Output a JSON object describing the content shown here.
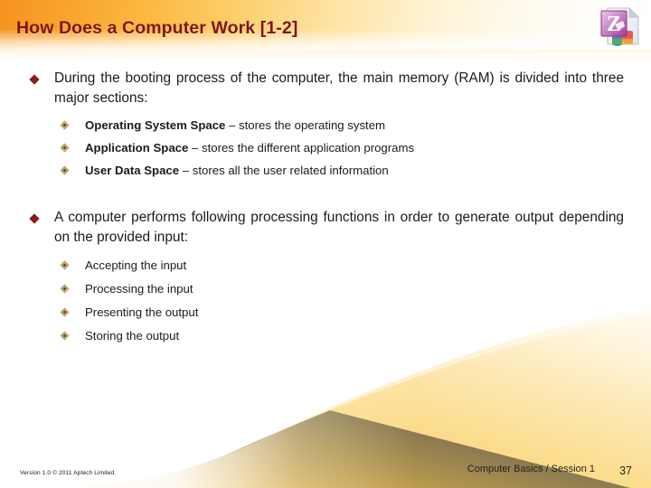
{
  "slide": {
    "title": "How Does a Computer Work [1-2]",
    "title_color": "#7d1519",
    "accent_orange": "#f5931f",
    "accent_gold": "#f7cf66",
    "bullet_color": "#8d1b1b",
    "subbullet_color": "#b59a62"
  },
  "icon": {
    "name": "zip-archive-document-icon",
    "glyph": "Z",
    "glyph_color": "#a3459b"
  },
  "body": {
    "blocks": [
      {
        "bullet": "During the booting process of the computer, the main memory (RAM) is divided into three major sections:",
        "sub_items": [
          {
            "term": "Operating System Space",
            "rest": " – stores the operating system"
          },
          {
            "term": "Application Space",
            "rest": " – stores the different application programs"
          },
          {
            "term": "User Data Space",
            "rest": " – stores all the user related information"
          }
        ]
      },
      {
        "bullet": "A computer performs following processing functions in order to generate output depending on the provided input:",
        "sub_items": [
          {
            "term": "",
            "rest": "Accepting the input"
          },
          {
            "term": "",
            "rest": "Processing the input"
          },
          {
            "term": "",
            "rest": "Presenting the output"
          },
          {
            "term": "",
            "rest": "Storing the output"
          }
        ]
      }
    ]
  },
  "footer": {
    "version": "Version 1.0 © 2011 Aptech Limited.",
    "course": "Computer Basics / Session 1",
    "page": "37"
  }
}
